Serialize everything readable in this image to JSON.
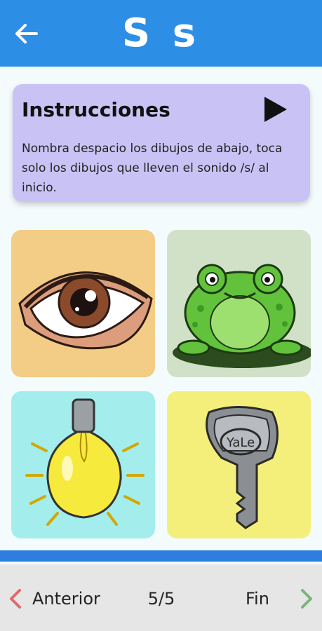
{
  "header": {
    "title": "S s",
    "back_icon": "arrow-left-icon",
    "color": "#2d8ee6"
  },
  "instructions": {
    "title": "Instrucciones",
    "body": "Nombra despacio los dibujos de abajo, toca solo los dibujos que lleven el sonido /s/ al inicio.",
    "play_icon": "play-icon",
    "background": "#c9c3f5"
  },
  "pictures": [
    {
      "name": "eye",
      "background": "#f3cc86"
    },
    {
      "name": "frog",
      "background": "#d0e1c8"
    },
    {
      "name": "light-bulb",
      "background": "#a3eeec"
    },
    {
      "name": "key",
      "background": "#f4ef7a",
      "engraving": "YaLe"
    }
  ],
  "progress": {
    "fraction": 1.0,
    "color": "#2d7ee0"
  },
  "footer": {
    "prev_label": "Anterior",
    "counter": "5/5",
    "next_label": "Fin",
    "prev_icon": "chevron-left-icon",
    "next_icon": "chevron-right-icon",
    "prev_color": "#e06a6a",
    "next_color": "#7ab57a"
  }
}
